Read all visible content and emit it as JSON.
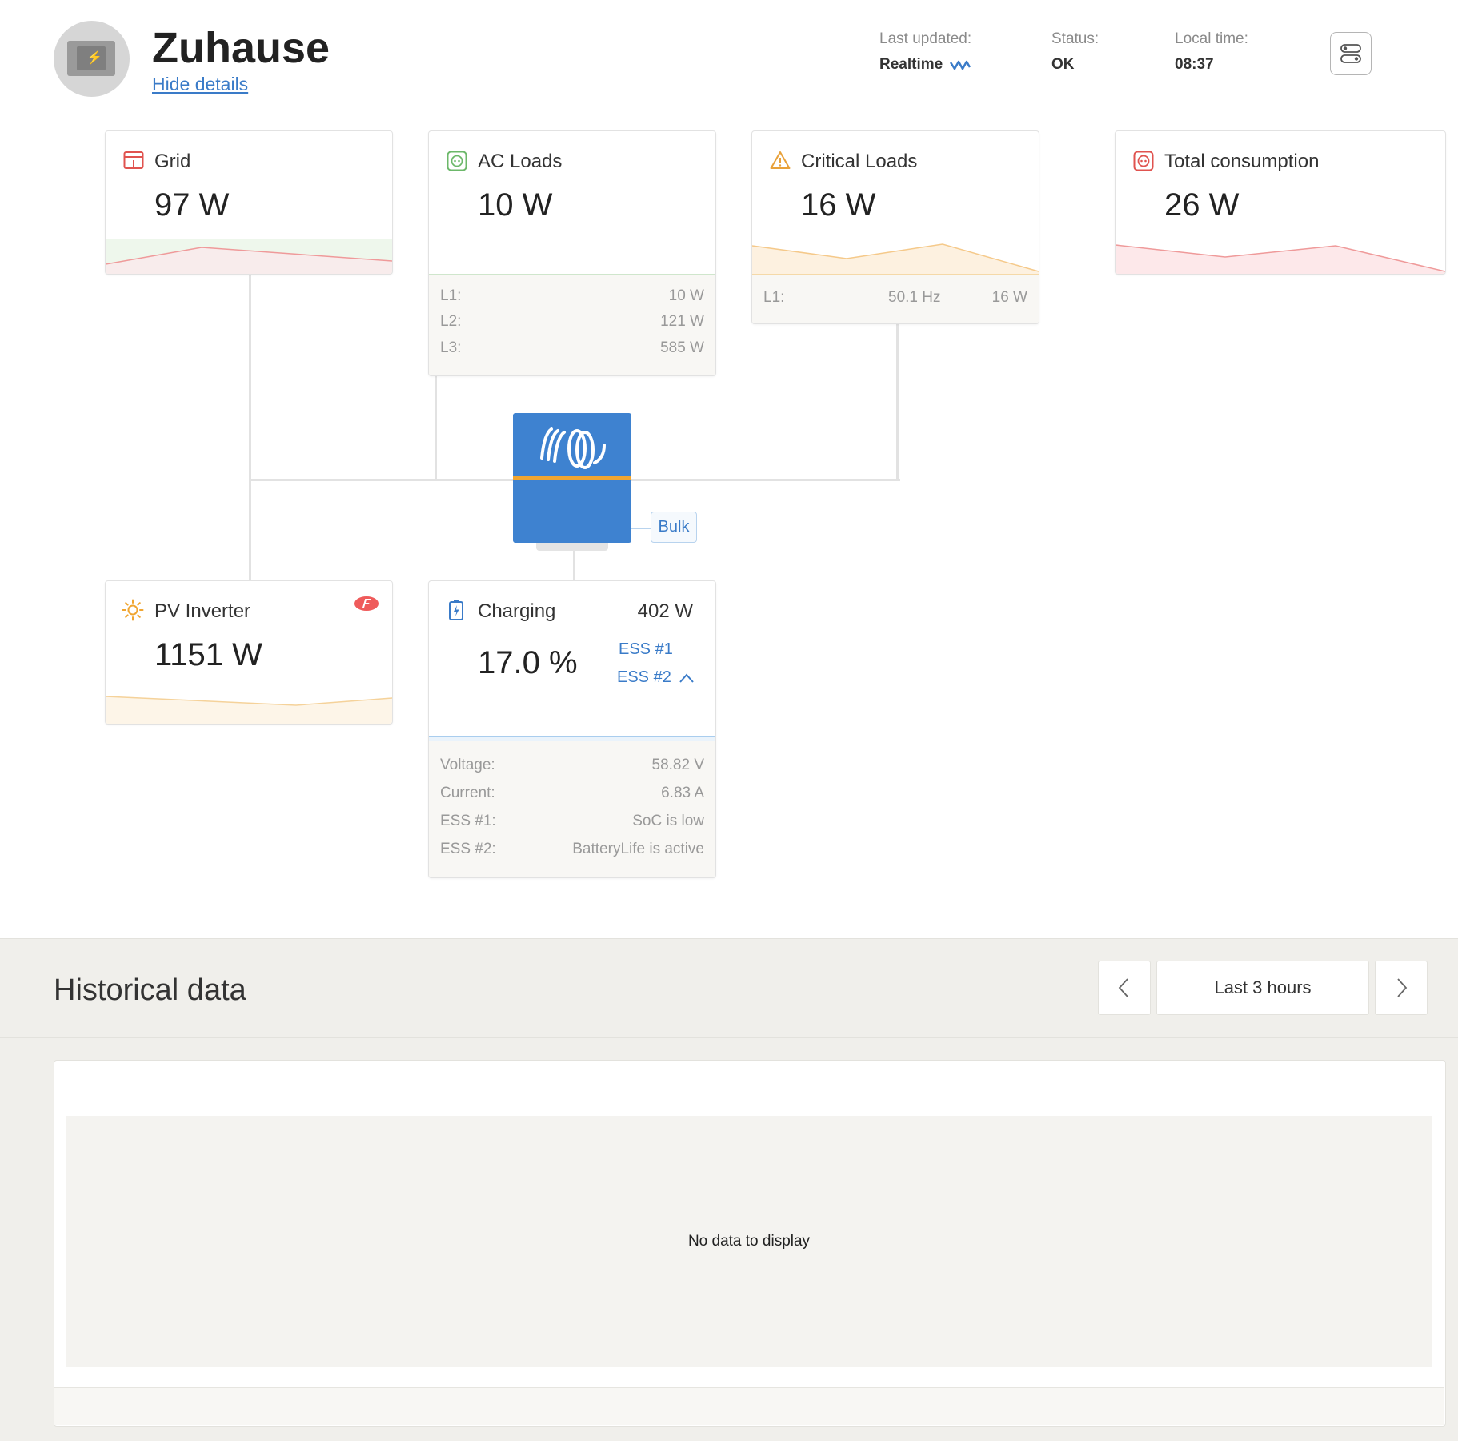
{
  "header": {
    "site_name": "Zuhause",
    "hide_details": "Hide details",
    "last_updated_label": "Last updated:",
    "last_updated_value": "Realtime",
    "status_label": "Status:",
    "status_value": "OK",
    "local_time_label": "Local time:",
    "local_time_value": "08:37"
  },
  "grid": {
    "title": "Grid",
    "value": "97 W"
  },
  "ac_loads": {
    "title": "AC Loads",
    "value": "10 W",
    "phases": [
      {
        "label": "L1:",
        "value": "10 W"
      },
      {
        "label": "L2:",
        "value": "121 W"
      },
      {
        "label": "L3:",
        "value": "585 W"
      }
    ]
  },
  "critical_loads": {
    "title": "Critical Loads",
    "value": "16 W",
    "phases": [
      {
        "label": "L1:",
        "freq": "50.1 Hz",
        "value": "16 W"
      }
    ]
  },
  "total_consumption": {
    "title": "Total consumption",
    "value": "26 W"
  },
  "inverter": {
    "state": "Bulk"
  },
  "pv_inverter": {
    "title": "PV Inverter",
    "value": "1151 W"
  },
  "battery": {
    "title": "Charging",
    "power": "402 W",
    "soc": "17.0 %",
    "ess1_link": "ESS #1",
    "ess2_link": "ESS #2",
    "details": [
      {
        "label": "Voltage:",
        "value": "58.82 V"
      },
      {
        "label": "Current:",
        "value": "6.83 A"
      },
      {
        "label": "ESS #1:",
        "value": "SoC is low"
      },
      {
        "label": "ESS #2:",
        "value": "BatteryLife is active"
      }
    ]
  },
  "historical": {
    "title": "Historical data",
    "range": "Last 3 hours",
    "empty_message": "No data to display"
  },
  "colors": {
    "accent_blue": "#3a7bc8",
    "inverter_blue": "#3e82d0",
    "grid_red": "#e0534f",
    "ac_green": "#6cb86a",
    "critical_orange": "#e8a13a",
    "pv_orange": "#f0a530"
  }
}
